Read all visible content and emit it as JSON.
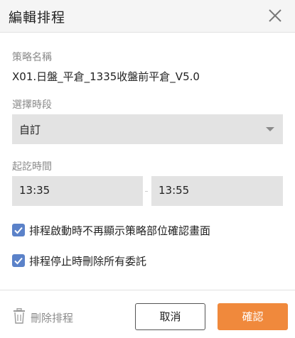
{
  "dialog": {
    "title": "編輯排程",
    "close_icon": "close-icon"
  },
  "strategy": {
    "label": "策略名稱",
    "value": "X01.日盤_平倉_1335收盤前平倉_V5.0"
  },
  "period": {
    "label": "選擇時段",
    "selected": "自訂"
  },
  "time_range": {
    "label": "起訖時間",
    "start": "13:35",
    "end": "13:55"
  },
  "options": [
    {
      "label": "排程啟動時不再顯示策略部位確認畫面",
      "checked": true
    },
    {
      "label": "排程停止時刪除所有委託",
      "checked": true
    }
  ],
  "footer": {
    "delete_label": "刪除排程",
    "cancel_label": "取消",
    "confirm_label": "確認"
  },
  "colors": {
    "accent": "#f0893c",
    "checkbox": "#5b82c9",
    "field_bg": "#e3e3e3",
    "header_bg": "#f5f5f5"
  }
}
